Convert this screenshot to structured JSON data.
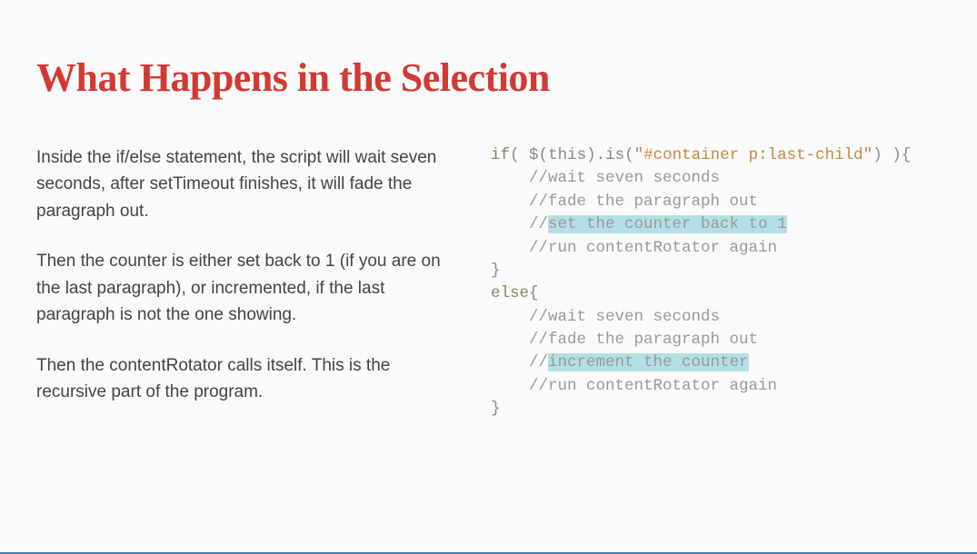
{
  "title": "What Happens in the Selection",
  "paragraphs": [
    "Inside the if/else statement, the script will wait seven seconds, after setTimeout finishes, it will fade the paragraph out.",
    "Then the counter is either set back to 1 (if you are on the last paragraph), or incremented, if the last paragraph is not the one showing.",
    "Then the contentRotator calls itself. This is the recursive part of the program."
  ],
  "code": {
    "kw_if": "if",
    "paren_open": "(",
    "space": " ",
    "dollar": "$(",
    "this": "this",
    "close_p": ")",
    "dot": ".",
    "is": "is",
    "open_p2": "(",
    "selector": "\"#container p:last-child\"",
    "close_p2": ")",
    "close_p_outer": " )",
    "brace_open": "{",
    "indent": "    ",
    "c1": "//wait seven seconds",
    "c2": "//fade the paragraph out",
    "c3_prefix": "//",
    "c3_hl": "set the counter back to 1",
    "c4": "//run contentRotator again",
    "brace_close": "}",
    "kw_else": "else",
    "e_c1": "//wait seven seconds",
    "e_c2": "//fade the paragraph out",
    "e_c3_prefix": "//",
    "e_c3_hl": "increment the counter",
    "e_c4": "//run contentRotator again"
  }
}
